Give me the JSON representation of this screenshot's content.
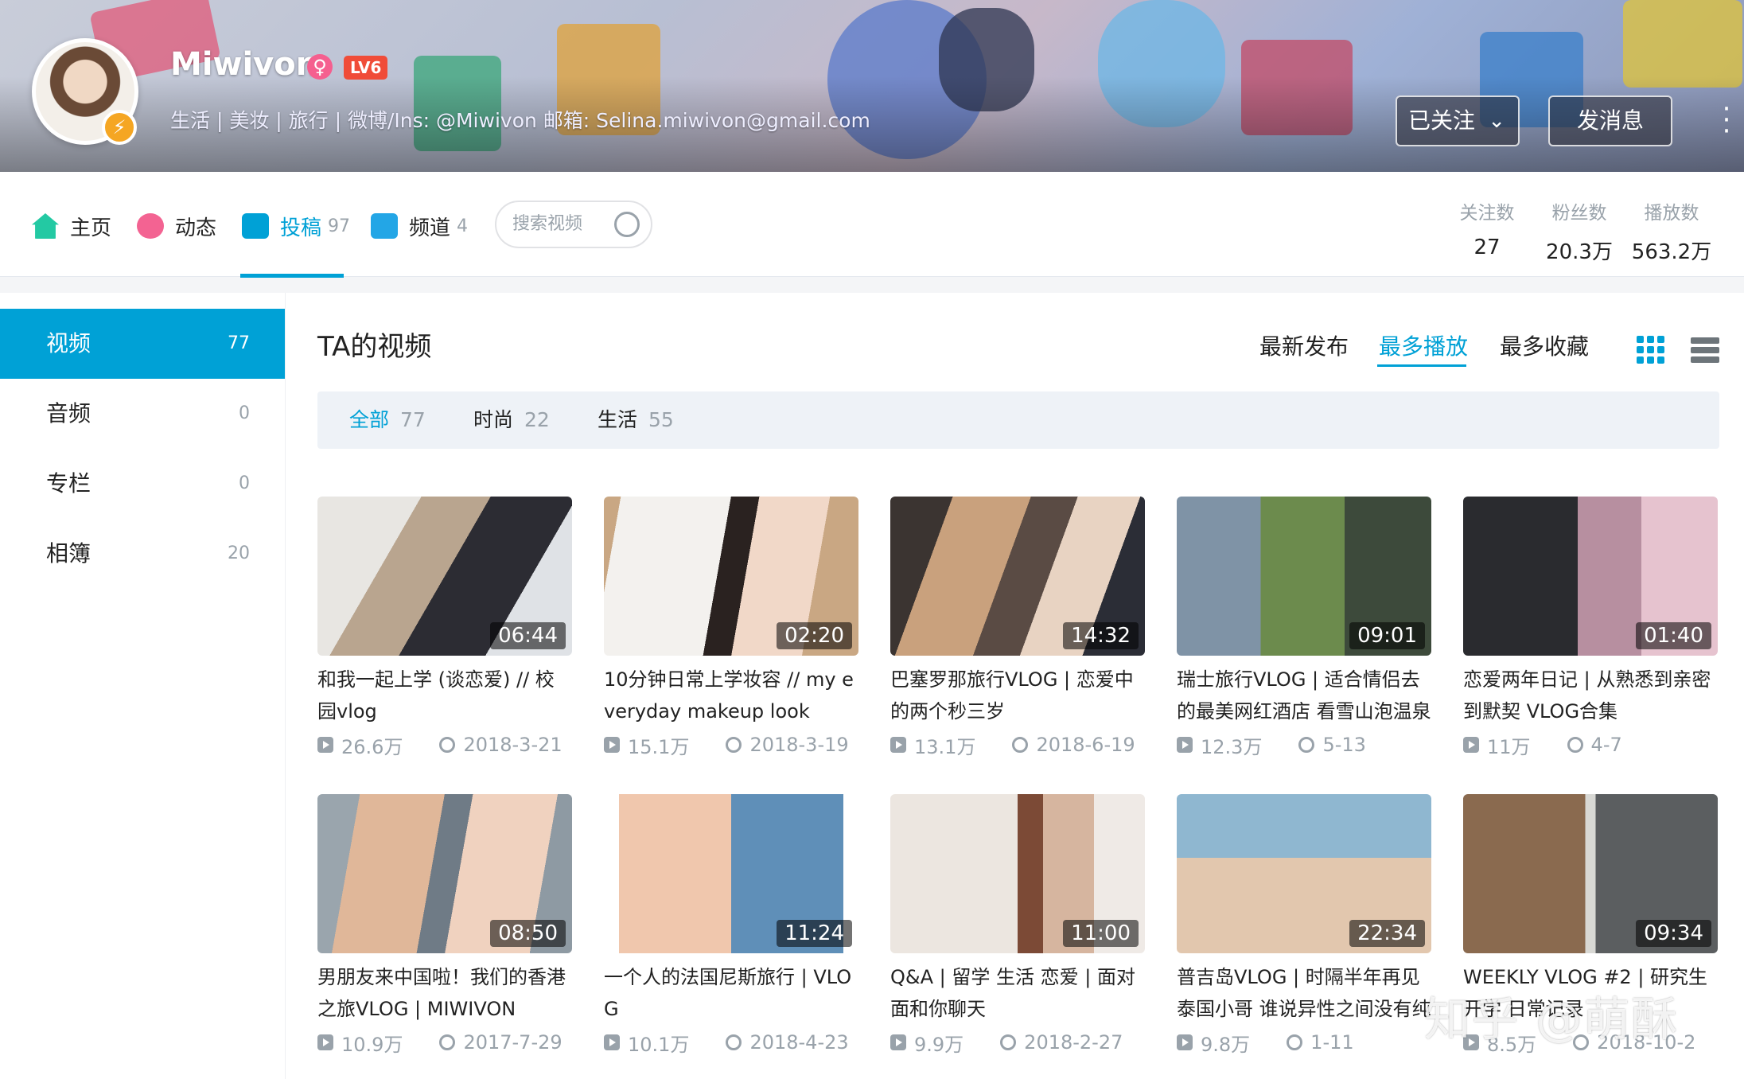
{
  "header": {
    "username": "Miwivon",
    "gender_icon": "female-icon",
    "gender_symbol": "♀",
    "level": "LV6",
    "bio": "生活 | 美妆 | 旅行 | 微博/Ins: @Miwivon 邮箱: Selina.miwivon@gmail.com",
    "follow_label": "已关注",
    "message_label": "发消息"
  },
  "nav": {
    "items": [
      {
        "label": "主页",
        "count": ""
      },
      {
        "label": "动态",
        "count": ""
      },
      {
        "label": "投稿",
        "count": "97"
      },
      {
        "label": "频道",
        "count": "4"
      }
    ],
    "search_placeholder": "搜索视频",
    "stats": [
      {
        "label": "关注数",
        "value": "27"
      },
      {
        "label": "粉丝数",
        "value": "20.3万"
      },
      {
        "label": "播放数",
        "value": "563.2万"
      }
    ]
  },
  "sidebar": {
    "items": [
      {
        "label": "视频",
        "count": "77"
      },
      {
        "label": "音频",
        "count": "0"
      },
      {
        "label": "专栏",
        "count": "0"
      },
      {
        "label": "相簿",
        "count": "20"
      }
    ]
  },
  "main": {
    "title": "TA的视频",
    "sort": [
      "最新发布",
      "最多播放",
      "最多收藏"
    ],
    "filters": [
      {
        "label": "全部",
        "count": "77"
      },
      {
        "label": "时尚",
        "count": "22"
      },
      {
        "label": "生活",
        "count": "55"
      }
    ],
    "videos": [
      {
        "title": "和我一起上学 (谈恋爱) // 校园vlog",
        "duration": "06:44",
        "views": "26.6万",
        "date": "2018-3-21"
      },
      {
        "title": "10分钟日常上学妆容 // my everyday makeup look",
        "duration": "02:20",
        "views": "15.1万",
        "date": "2018-3-19"
      },
      {
        "title": "巴塞罗那旅行VLOG | 恋爱中的两个秒三岁",
        "duration": "14:32",
        "views": "13.1万",
        "date": "2018-6-19"
      },
      {
        "title": "瑞士旅行VLOG | 适合情侣去的最美网红酒店 看雪山泡温泉",
        "duration": "09:01",
        "views": "12.3万",
        "date": "5-13"
      },
      {
        "title": "恋爱两年日记 | 从熟悉到亲密到默契 VLOG合集",
        "duration": "01:40",
        "views": "11万",
        "date": "4-7"
      },
      {
        "title": "男朋友来中国啦！我们的香港之旅VLOG | MIWIVON",
        "duration": "08:50",
        "views": "10.9万",
        "date": "2017-7-29"
      },
      {
        "title": "一个人的法国尼斯旅行 | VLOG",
        "duration": "11:24",
        "views": "10.1万",
        "date": "2018-4-23"
      },
      {
        "title": "Q&A | 留学 生活 恋爱 | 面对面和你聊天",
        "duration": "11:00",
        "views": "9.9万",
        "date": "2018-2-27"
      },
      {
        "title": "普吉岛VLOG | 时隔半年再见泰国小哥 谁说异性之间没有纯",
        "duration": "22:34",
        "views": "9.8万",
        "date": "1-11"
      },
      {
        "title": "WEEKLY VLOG #2 | 研究生开学 日常记录",
        "duration": "09:34",
        "views": "8.5万",
        "date": "2018-10-2"
      }
    ]
  },
  "watermark": "知乎 @萌酥",
  "colors": {
    "accent": "#00a1d6",
    "level": "#f04c38",
    "gender": "#f55f8f",
    "verify": "#f5a623"
  }
}
